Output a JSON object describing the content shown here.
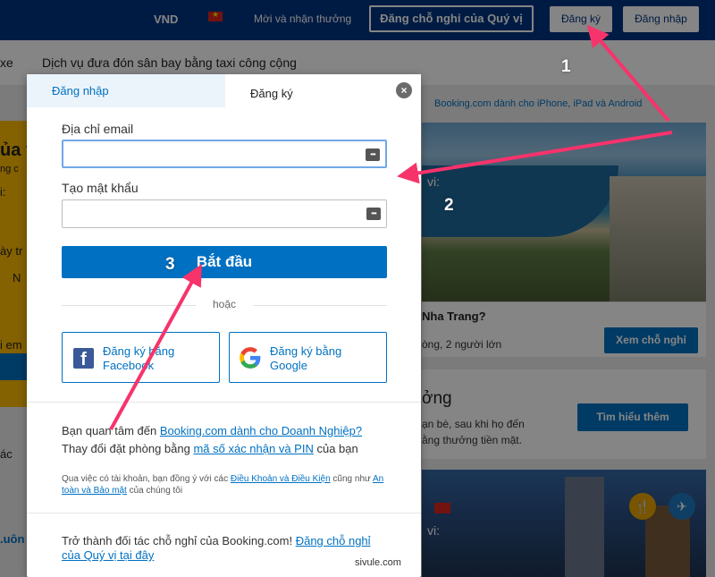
{
  "topbar": {
    "currency": "VND",
    "rewards": "Mời và nhận thưởng",
    "list_property": "Đăng chỗ nghỉ của Quý vị",
    "register": "Đăng ký",
    "login": "Đăng nhập"
  },
  "subnav": {
    "left_partial": "xe",
    "taxi": "Dịch vụ đưa đón sân bay bằng taxi công cộng"
  },
  "background": {
    "apps_link": "Booking.com dành cho iPhone, iPad và Android",
    "hero_caption": "vi:",
    "card1_title": "Nha Trang?",
    "card1_sub": "òng, 2 người lớn",
    "card1_button": "Xem chỗ nghỉ",
    "card2_title": "ởng",
    "card2_line1": "ạn bè, sau khi họ đến",
    "card2_line2": "ằng thưởng tiền mặt.",
    "card2_button": "Tìm hiểu thêm",
    "hero2_caption": "vi:",
    "left_frag1": "ủa t",
    "left_frag2": "ng c",
    "left_frag3": "i:",
    "left_frag4": "ày tr",
    "left_frag5": "N",
    "left_frag6": "i em",
    "left_frag7": "ác",
    "left_frag8": ".uôn"
  },
  "modal": {
    "tab_login": "Đăng nhập",
    "tab_register": "Đăng ký",
    "close_symbol": "×",
    "email_label": "Địa chỉ email",
    "email_value": "",
    "password_label": "Tạo mật khẩu",
    "password_value": "",
    "password_icon": "•••",
    "start_button": "Bắt đầu",
    "or_text": "hoặc",
    "facebook_button": "Đăng ký bằng Facebook",
    "google_button": "Đăng ký bằng Google",
    "biz_prefix": "Bạn quan tâm đến ",
    "biz_link": "Booking.com dành cho Doanh Nghiệp?",
    "pin_prefix": "Thay đổi đặt phòng bằng ",
    "pin_link": "mã số xác nhận và PIN",
    "pin_suffix": " của bạn",
    "terms_prefix": "Qua việc có tài khoản, bạn đồng ý với các ",
    "terms_link": "Điều Khoản và Điều Kiện",
    "terms_mid": " cũng như ",
    "privacy_link": "An toàn và Bảo mật",
    "terms_suffix": " của chúng tôi",
    "partner_prefix": "Trở thành đối tác chỗ nghỉ của Booking.com! ",
    "partner_link": "Đăng chỗ nghỉ của Quý vị tại đây"
  },
  "annotations": {
    "step1": "1",
    "step2": "2",
    "step3": "3",
    "watermark": "sivule.com",
    "arrow_color": "#f7336b"
  },
  "colors": {
    "brand_dark": "#003580",
    "brand_blue": "#0071c2",
    "yellow": "#febb02"
  }
}
